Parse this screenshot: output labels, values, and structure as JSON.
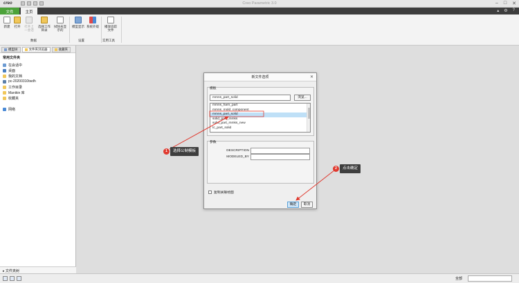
{
  "app": {
    "logo": "creo",
    "window_title": "Creo Parametric 3.0"
  },
  "ribbon_tabs": {
    "file": "文件",
    "home": "主页"
  },
  "ribbon": {
    "new": "新建",
    "open": "打开",
    "open_last": "打开上一会话",
    "select_dir": "选择工作目录",
    "erase": "拭除未显示的",
    "model_display": "模型显示",
    "system_appearance": "系统外观",
    "play_trail": "播放追踪文件",
    "group_data": "数据",
    "group_settings": "设置",
    "group_utilities": "实用工具"
  },
  "left_panel": {
    "tabs": [
      "模型树",
      "文件夹浏览器",
      "收藏夹"
    ],
    "common_folders_title": "常用文件夹",
    "items": [
      "在会话中",
      "桌面",
      "我的文档",
      "pc-20200310twdh",
      "工作目录",
      "Manikin 库",
      "收藏夹"
    ],
    "network": "网络",
    "folder_tree": "文件夹树"
  },
  "dialog": {
    "title": "新文件选项",
    "template_label": "模板",
    "template_value": "mmns_part_solid",
    "browse": "浏览...",
    "templates": [
      "mmns_harn_part",
      "mmns_mold_component",
      "mmns_part_solid",
      "solid_part_mmks",
      "solid_part_mmks_new",
      "tc_part_solid"
    ],
    "selected_index": 2,
    "params_label": "参数",
    "params": [
      {
        "name": "DESCRIPTION",
        "value": ""
      },
      {
        "name": "MODELED_BY",
        "value": ""
      }
    ],
    "copy_drawings": "复制关联绘图",
    "ok": "确定",
    "cancel": "取消"
  },
  "annotations": {
    "step1_num": "1",
    "step1_text": "选择公制模板",
    "step2_num": "2",
    "step2_text": "点击确定"
  },
  "statusbar": {
    "filter_label": "全部"
  },
  "colors": {
    "accent_green": "#4ca23a",
    "annotation_red": "#e03a2f",
    "selection_blue": "#bfe0f7"
  }
}
